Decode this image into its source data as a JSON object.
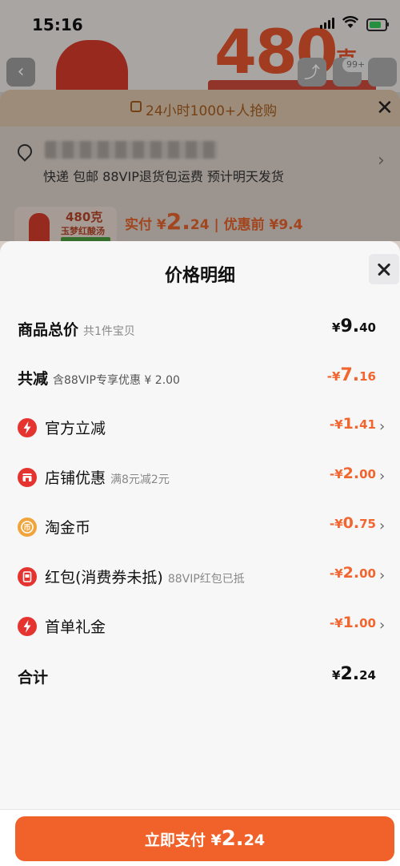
{
  "status_bar": {
    "time": "15:16"
  },
  "background_page": {
    "hero_number": "480",
    "hero_unit": "克",
    "cart_badge": "99+",
    "back_icon": "chevron-left-icon",
    "share_icon": "share-icon",
    "cart_icon": "cart-icon"
  },
  "sku_sheet": {
    "banner_text": "24小时1000+人抢购",
    "shipping_text": "快递  包邮  88VIP退货包运费  预计明天发货",
    "product_grams": "480克",
    "product_name": "玉梦红酸汤",
    "price_prefix": "实付 ¥",
    "price_int": "2.",
    "price_dec": "24",
    "price_before": " | 优惠前 ¥9.4"
  },
  "detail": {
    "title": "价格明细",
    "rows": [
      {
        "label": "商品总价",
        "sub": "共1件宝贝",
        "currency": "¥",
        "int": "9.",
        "dec": "40",
        "color": "#111111",
        "icon": ""
      },
      {
        "label": "共减",
        "sub": "含88VIP专享优惠 ¥ 2.00",
        "currency": "-¥",
        "int": "7.",
        "dec": "16",
        "color": "#f2652e",
        "icon": ""
      },
      {
        "label": "官方立减",
        "sub": "",
        "currency": "-¥",
        "int": "1.",
        "dec": "41",
        "color": "#f2652e",
        "icon": "lightning-icon"
      },
      {
        "label": "店铺优惠",
        "sub": "满8元减2元",
        "currency": "-¥",
        "int": "2.",
        "dec": "00",
        "color": "#f2652e",
        "icon": "store-icon"
      },
      {
        "label": "淘金币",
        "sub": "",
        "currency": "-¥",
        "int": "0.",
        "dec": "75",
        "color": "#f2652e",
        "icon": "coin-icon"
      },
      {
        "label": "红包(消费券未抵)",
        "sub": "88VIP红包已抵",
        "currency": "-¥",
        "int": "2.",
        "dec": "00",
        "color": "#f2652e",
        "icon": "red-packet-icon"
      },
      {
        "label": "首单礼金",
        "sub": "",
        "currency": "-¥",
        "int": "1.",
        "dec": "00",
        "color": "#f2652e",
        "icon": "lightning-icon"
      },
      {
        "label": "合计",
        "sub": "",
        "currency": "¥",
        "int": "2.",
        "dec": "24",
        "color": "#111111",
        "icon": ""
      }
    ]
  },
  "pay_button": {
    "label": "立即支付",
    "currency": "¥",
    "int": "2.",
    "dec": "24"
  },
  "colors": {
    "accent": "#f1622b",
    "discount": "#f2652e",
    "icon_red": "#e5332f",
    "icon_gold": "#f0a43a"
  }
}
